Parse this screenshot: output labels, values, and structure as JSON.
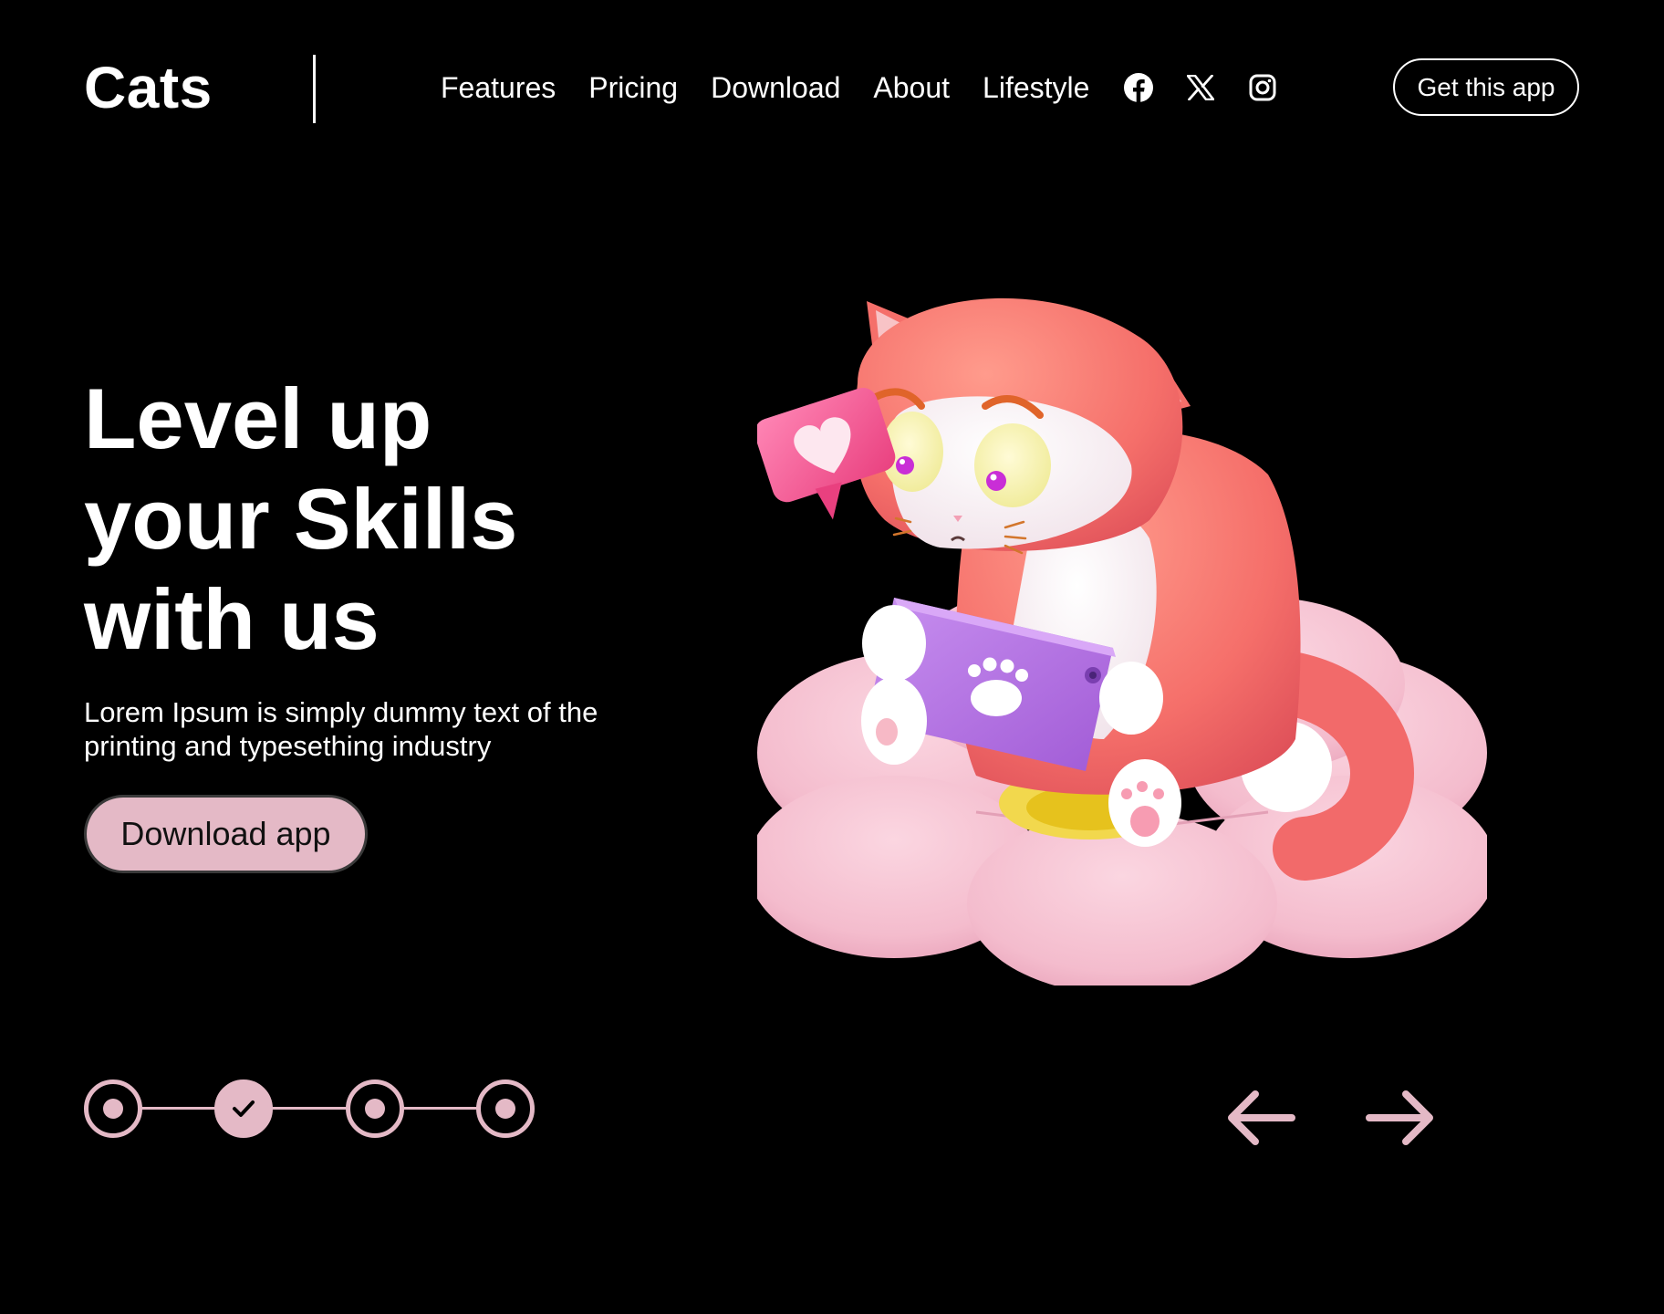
{
  "header": {
    "logo": "Cats",
    "nav": [
      {
        "label": "Features"
      },
      {
        "label": "Pricing"
      },
      {
        "label": "Download"
      },
      {
        "label": "About"
      },
      {
        "label": "Lifestyle"
      }
    ],
    "social_icons": [
      "facebook-icon",
      "x-icon",
      "instagram-icon"
    ],
    "cta_label": "Get this app"
  },
  "hero": {
    "title_lines": [
      "Level up",
      "your Skills",
      "with us"
    ],
    "subtitle_lines": [
      "Lorem Ipsum is simply dummy text of the",
      "printing and typesething industry"
    ],
    "download_label": "Download app"
  },
  "stepper": {
    "steps": [
      {
        "state": "current"
      },
      {
        "state": "completed"
      },
      {
        "state": "upcoming"
      },
      {
        "state": "upcoming"
      }
    ]
  },
  "carousel": {
    "prev_icon": "arrow-left-icon",
    "next_icon": "arrow-right-icon"
  },
  "theme": {
    "background": "#000000",
    "text": "#ffffff",
    "accent_pink": "#e4b9c6",
    "cat_body": "#f57b73",
    "flower": "#f4c6d4",
    "tablet": "#b772e0",
    "heart_bubble": "#f0609a"
  }
}
